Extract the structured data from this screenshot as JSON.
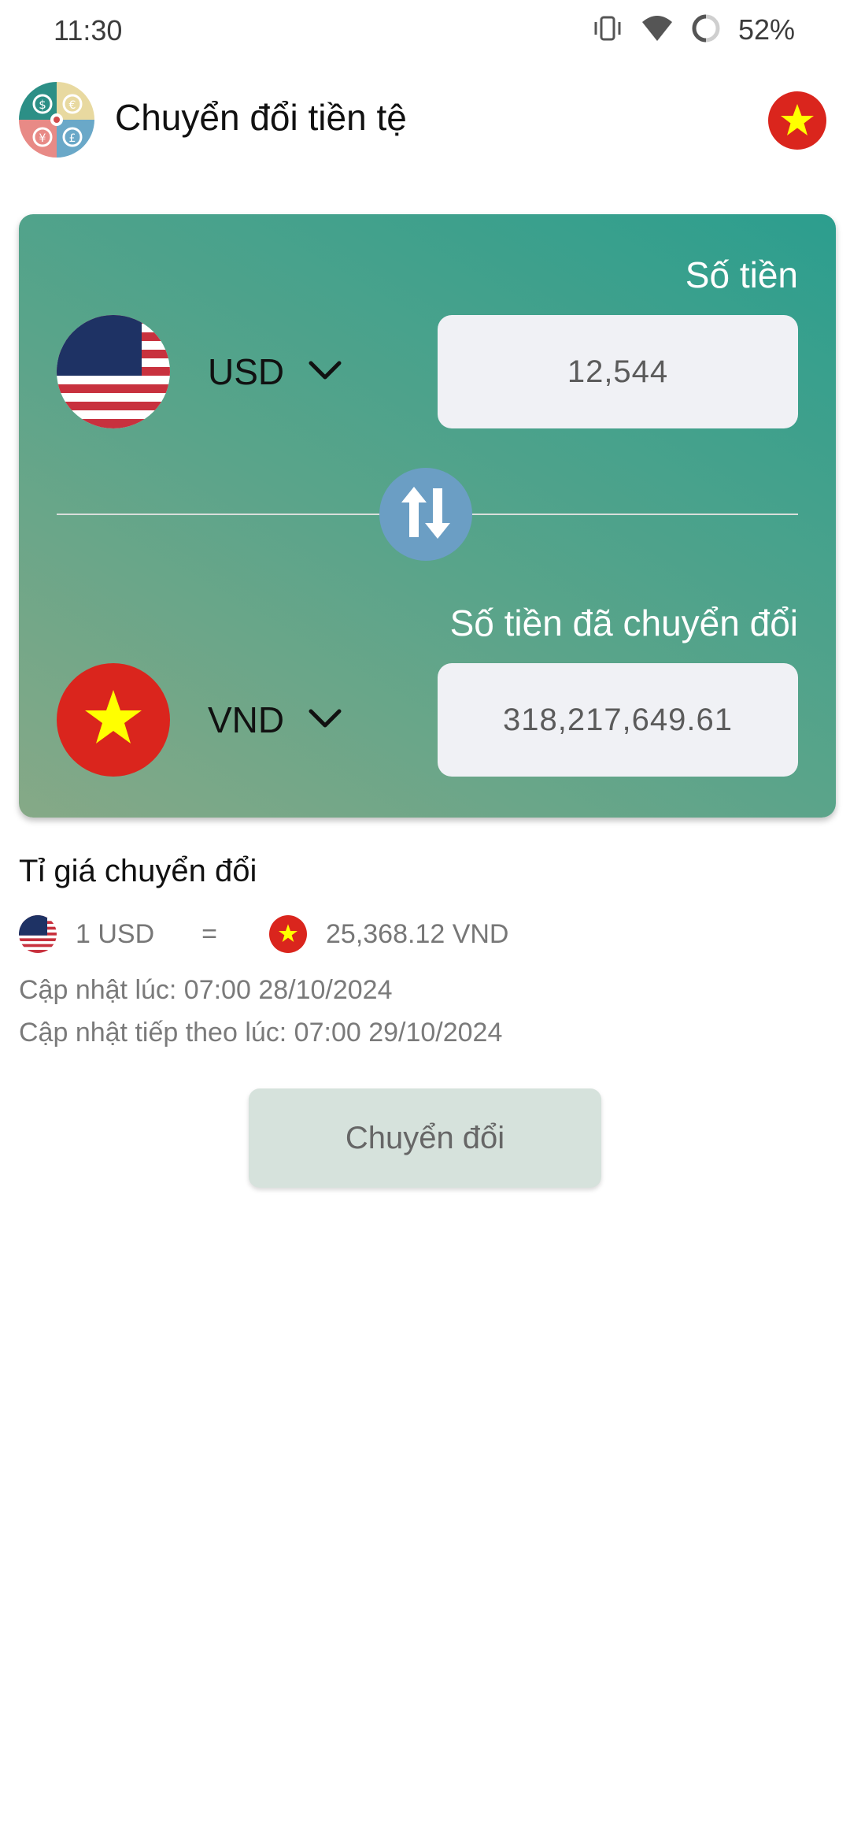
{
  "status_bar": {
    "time": "11:30",
    "battery": "52%",
    "icons": [
      "vibrate-icon",
      "wifi-icon",
      "battery-icon"
    ]
  },
  "header": {
    "title": "Chuyển đổi tiền tệ",
    "logo_icon": "currency-logo-icon",
    "language_flag": "vietnam-flag-icon"
  },
  "converter": {
    "amount_label": "Số tiền",
    "from_currency": "USD",
    "from_amount": "12,544",
    "to_label": "Số tiền đã chuyển đổi",
    "to_currency": "VND",
    "to_amount": "318,217,649.61",
    "swap_icon": "swap-arrows-icon",
    "gradient_colors": [
      "#86a987",
      "#2c9e8e"
    ]
  },
  "rate": {
    "title": "Tỉ giá chuyển đổi",
    "from_text": "1 USD",
    "equals": "=",
    "to_text": "25,368.12 VND",
    "updated": "Cập nhật lúc: 07:00 28/10/2024",
    "next_update": "Cập nhật tiếp theo lúc: 07:00 29/10/2024"
  },
  "convert_button_label": "Chuyển đổi"
}
